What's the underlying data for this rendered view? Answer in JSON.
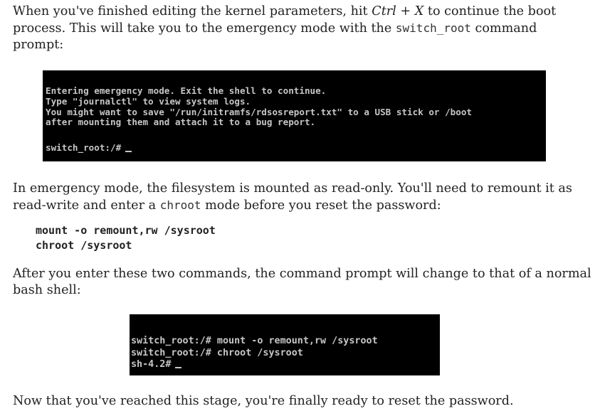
{
  "paragraph1": {
    "line1_a": "When you've finished editing the kernel parameters, hit ",
    "key_ctrl": "Ctrl",
    "line1_plus": " + ",
    "key_x": "X",
    "line1_b": " to continue the boot",
    "line2_a": "process. This will take you to the emergency mode with the ",
    "line2_code": "switch_root",
    "line2_b": " command",
    "line3": "prompt:"
  },
  "terminal1": {
    "lines": [
      "Entering emergency mode. Exit the shell to continue.",
      "Type \"journalctl\" to view system logs.",
      "You might want to save \"/run/initramfs/rdsosreport.txt\" to a USB stick or /boot",
      "after mounting them and attach it to a bug report."
    ],
    "prompt": "switch_root:/#"
  },
  "paragraph2": {
    "line1": "In emergency mode, the filesystem is mounted as read-only. You'll need to remount it as",
    "line2_a": "read-write and enter a ",
    "line2_code": "chroot",
    "line2_b": " mode before you reset the password:"
  },
  "code_block": {
    "lines": [
      "mount -o remount,rw /sysroot",
      "chroot /sysroot"
    ]
  },
  "paragraph3": {
    "line1": "After you enter these two commands, the command prompt will change to that of a normal",
    "line2": "bash shell:"
  },
  "terminal2": {
    "lines": [
      "switch_root:/# mount -o remount,rw /sysroot",
      "switch_root:/# chroot /sysroot"
    ],
    "prompt": "sh-4.2#"
  },
  "paragraph4": {
    "line1": "Now that you've reached this stage, you're finally ready to reset the password."
  }
}
